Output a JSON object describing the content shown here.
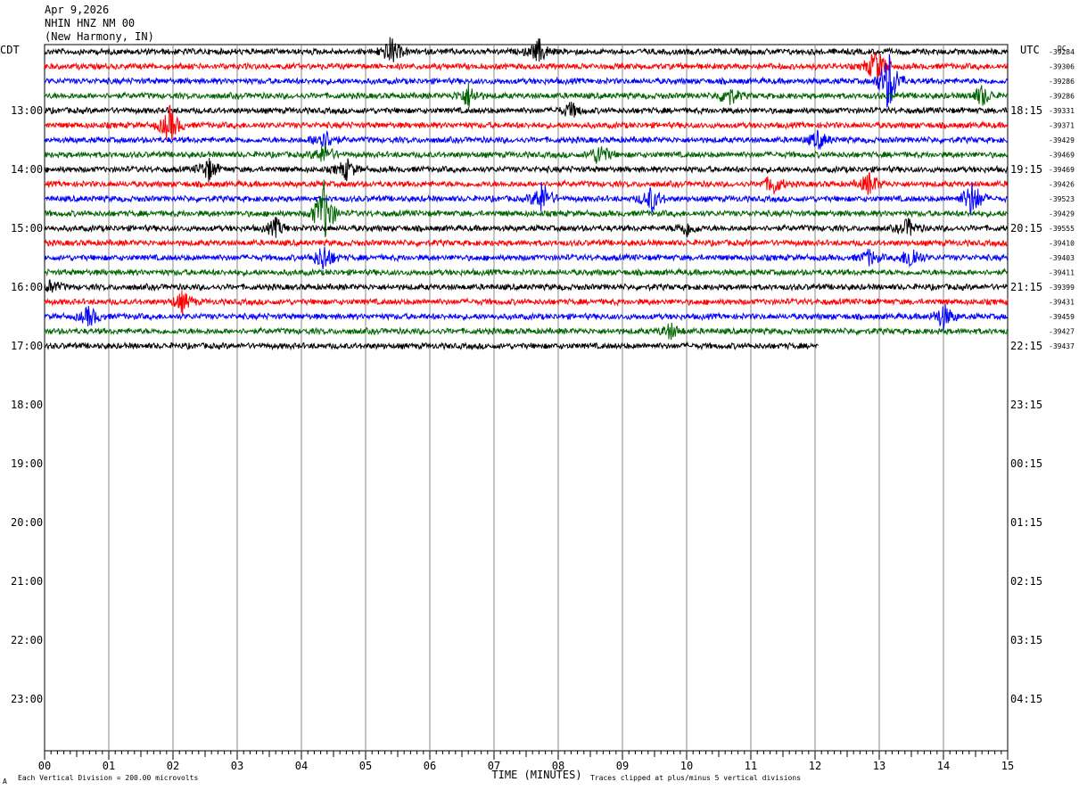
{
  "header": {
    "date": "Apr 9,2026",
    "station": "NHIN HNZ NM 00",
    "location": "(New Harmony, IN)"
  },
  "left_tz": "CDT",
  "right_tz": "UTC",
  "dc_label": "DC",
  "footer": {
    "scale": "Each Vertical Division =  200.00 microvolts",
    "clip": "Traces clipped at plus/minus 5 vertical divisions",
    "corner_mark": "A"
  },
  "chart_data": {
    "type": "line",
    "xlabel": "TIME (MINUTES)",
    "xlim": [
      0,
      15
    ],
    "x_ticks": [
      "00",
      "01",
      "02",
      "03",
      "04",
      "05",
      "06",
      "07",
      "08",
      "09",
      "10",
      "11",
      "12",
      "13",
      "14",
      "15"
    ],
    "left_hour_labels": [
      "13:00",
      "14:00",
      "15:00",
      "16:00",
      "17:00",
      "18:00",
      "19:00",
      "20:00",
      "21:00",
      "22:00",
      "23:00"
    ],
    "right_hour_labels": [
      "18:15",
      "19:15",
      "20:15",
      "21:15",
      "22:15",
      "23:15",
      "00:15",
      "01:15",
      "02:15",
      "03:15",
      "04:15"
    ],
    "trace_colors": [
      "#000000",
      "#ff0000",
      "#0000ff",
      "#006400"
    ],
    "dc_offsets": [
      "-39284",
      "-39306",
      "-39286",
      "-39286",
      "-39331",
      "-39371",
      "-39429",
      "-39469",
      "-39469",
      "-39426",
      "-39523",
      "-39429",
      "-39555",
      "-39410",
      "-39403",
      "-39411",
      "-39399",
      "-39431",
      "-39459",
      "-39427",
      "-39437"
    ],
    "rows_recorded": 21,
    "last_row_end_minute": 12.05,
    "events": [
      {
        "row": 0,
        "minute": 5.4,
        "amp": 2.2
      },
      {
        "row": 0,
        "minute": 7.7,
        "amp": 1.8
      },
      {
        "row": 1,
        "minute": 12.95,
        "amp": 3.0
      },
      {
        "row": 2,
        "minute": 13.15,
        "amp": 5.0
      },
      {
        "row": 3,
        "minute": 6.6,
        "amp": 1.8
      },
      {
        "row": 3,
        "minute": 10.65,
        "amp": 1.6
      },
      {
        "row": 3,
        "minute": 14.6,
        "amp": 1.6
      },
      {
        "row": 4,
        "minute": 8.2,
        "amp": 1.2
      },
      {
        "row": 5,
        "minute": 1.95,
        "amp": 2.8
      },
      {
        "row": 6,
        "minute": 4.35,
        "amp": 2.0
      },
      {
        "row": 6,
        "minute": 12.05,
        "amp": 1.4
      },
      {
        "row": 7,
        "minute": 8.65,
        "amp": 1.8
      },
      {
        "row": 7,
        "minute": 4.35,
        "amp": 1.6
      },
      {
        "row": 8,
        "minute": 2.55,
        "amp": 1.8
      },
      {
        "row": 8,
        "minute": 4.7,
        "amp": 1.6
      },
      {
        "row": 9,
        "minute": 11.35,
        "amp": 1.6
      },
      {
        "row": 9,
        "minute": 12.85,
        "amp": 1.8
      },
      {
        "row": 10,
        "minute": 7.75,
        "amp": 2.6
      },
      {
        "row": 10,
        "minute": 9.45,
        "amp": 2.0
      },
      {
        "row": 10,
        "minute": 14.45,
        "amp": 3.0
      },
      {
        "row": 11,
        "minute": 4.35,
        "amp": 5.0
      },
      {
        "row": 12,
        "minute": 3.6,
        "amp": 1.4
      },
      {
        "row": 12,
        "minute": 10.0,
        "amp": 1.2
      },
      {
        "row": 12,
        "minute": 13.45,
        "amp": 1.4
      },
      {
        "row": 14,
        "minute": 13.5,
        "amp": 2.0
      },
      {
        "row": 14,
        "minute": 12.85,
        "amp": 1.2
      },
      {
        "row": 14,
        "minute": 4.35,
        "amp": 2.2
      },
      {
        "row": 16,
        "minute": 0.1,
        "amp": 1.0
      },
      {
        "row": 17,
        "minute": 2.15,
        "amp": 1.6
      },
      {
        "row": 18,
        "minute": 0.7,
        "amp": 1.6
      },
      {
        "row": 18,
        "minute": 14.0,
        "amp": 2.0
      },
      {
        "row": 19,
        "minute": 9.75,
        "amp": 1.2
      }
    ]
  }
}
